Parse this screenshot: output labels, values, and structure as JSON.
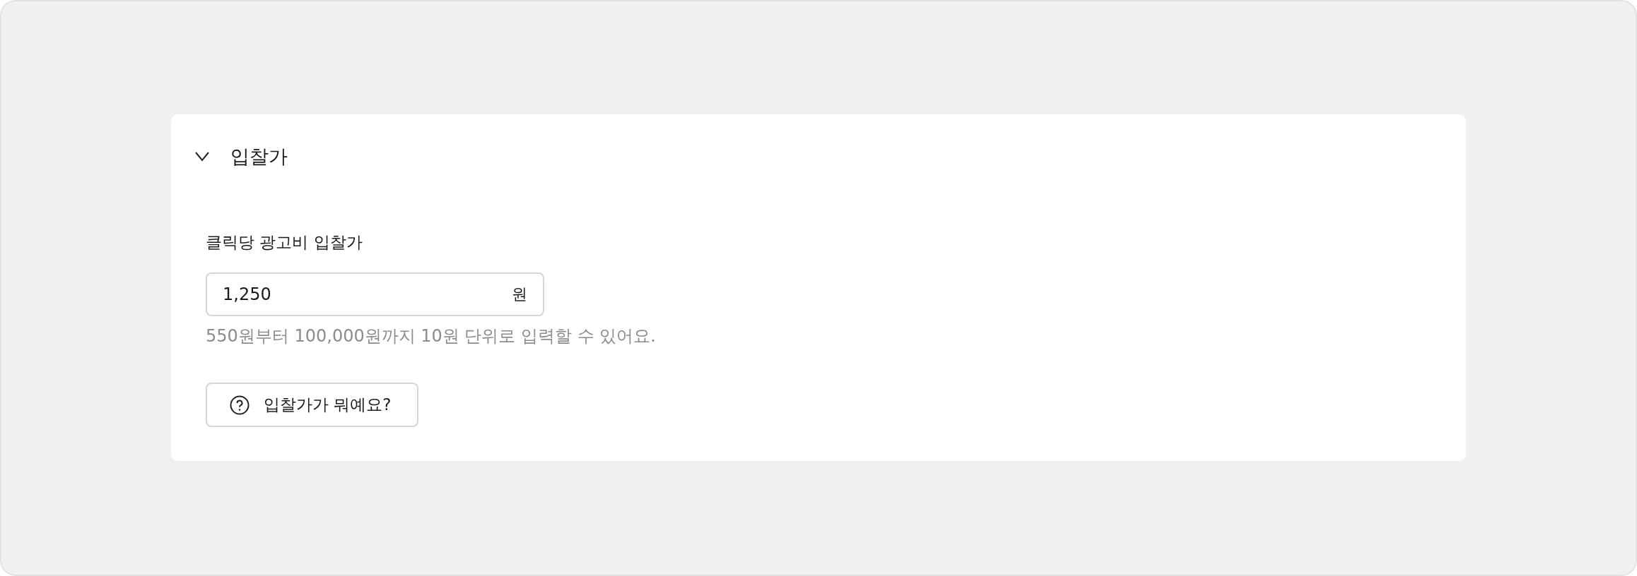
{
  "section": {
    "title": "입찰가",
    "expanded": true
  },
  "field": {
    "label": "클릭당 광고비 입찰가",
    "value": "1,250",
    "unit": "원",
    "help": "550원부터 100,000원까지 10원 단위로 입력할 수 있어요."
  },
  "help_button": {
    "label": "입찰가가 뭐예요?"
  }
}
